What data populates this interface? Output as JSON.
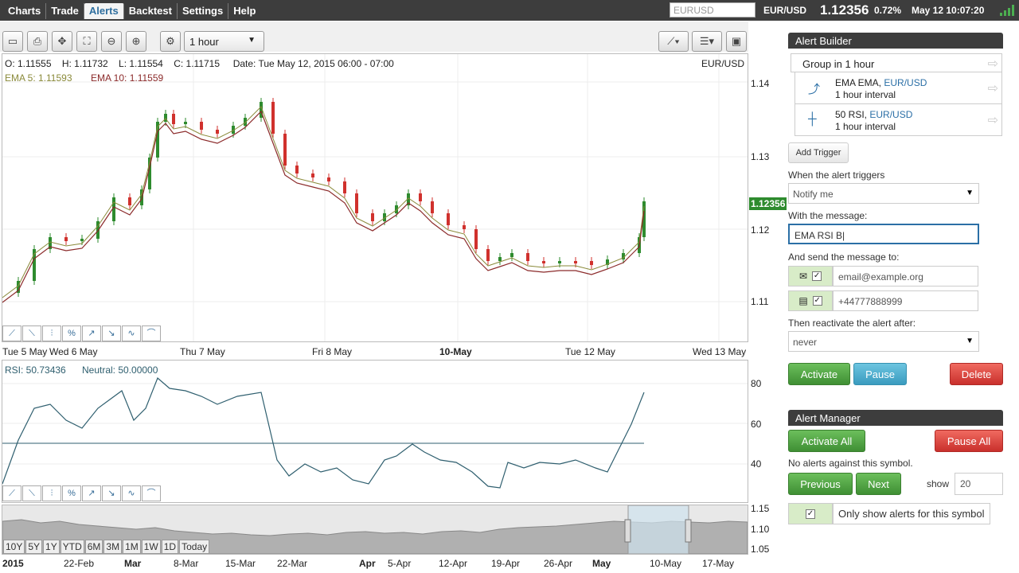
{
  "nav": {
    "items": [
      "Charts",
      "Trade",
      "Alerts",
      "Backtest",
      "Settings",
      "Help"
    ],
    "active": "Alerts"
  },
  "top": {
    "search_placeholder": "EURUSD",
    "symbol": "EUR/USD",
    "price": "1.12356",
    "change": "0.72%",
    "datetime": "May 12 10:07:20"
  },
  "toolbar": {
    "interval": "1 hour"
  },
  "ohlc": {
    "o": "O: 1.11555",
    "h": "H: 1.11732",
    "l": "L: 1.11554",
    "c": "C: 1.11715",
    "date": "Date: Tue May 12, 2015 06:00 - 07:00",
    "symbol": "EUR/USD"
  },
  "ema": {
    "ema5": "EMA 5: 1.11593",
    "ema10": "EMA 10: 1.11559"
  },
  "price_axis": [
    "1.14",
    "1.13",
    "1.12",
    "1.11"
  ],
  "price_tag": "1.12356",
  "time_axis": [
    "Tue 5 May",
    "Wed 6 May",
    "Thu 7 May",
    "Fri 8 May",
    "10-May",
    "Tue 12 May",
    "Wed 13 May"
  ],
  "rsi": {
    "label": "RSI: 50.73436",
    "neutral": "Neutral: 50.00000",
    "axis": [
      "80",
      "60",
      "40"
    ]
  },
  "nav_chart": {
    "axis": [
      "1.15",
      "1.10",
      "1.05"
    ],
    "dates": [
      "2015",
      "22-Feb",
      "Mar",
      "8-Mar",
      "15-Mar",
      "22-Mar",
      "Apr",
      "5-Apr",
      "12-Apr",
      "19-Apr",
      "26-Apr",
      "May",
      "10-May",
      "17-May"
    ],
    "zooms": [
      "10Y",
      "5Y",
      "1Y",
      "YTD",
      "6M",
      "3M",
      "1M",
      "1W",
      "1D",
      "Today"
    ]
  },
  "alert_builder": {
    "title": "Alert Builder",
    "group": "Group in 1 hour",
    "triggers": [
      {
        "name": "EMA EMA, ",
        "symbol": "EUR/USD",
        "interval": "1 hour interval"
      },
      {
        "name": "50 RSI, ",
        "symbol": "EUR/USD",
        "interval": "1 hour interval"
      }
    ],
    "add_trigger": "Add Trigger",
    "when_label": "When the alert triggers",
    "when_value": "Notify me",
    "message_label": "With the message:",
    "message_value": "EMA RSI B",
    "send_label": "And send the message to:",
    "email_placeholder": "email@example.org",
    "phone_placeholder": "+44777888999",
    "reactivate_label": "Then reactivate the alert after:",
    "reactivate_value": "never",
    "activate": "Activate",
    "pause": "Pause",
    "delete": "Delete"
  },
  "alert_manager": {
    "title": "Alert Manager",
    "activate_all": "Activate All",
    "pause_all": "Pause All",
    "no_alerts": "No alerts against this symbol.",
    "previous": "Previous",
    "next": "Next",
    "show_label": "show",
    "show_value": "20",
    "only_show": "Only show alerts for this symbol"
  },
  "colors": {
    "up": "#2e8b2e",
    "down": "#d0312d",
    "ema5": "#8a8a3a",
    "ema10": "#8b2a2a",
    "rsi": "#2f5f6f"
  }
}
